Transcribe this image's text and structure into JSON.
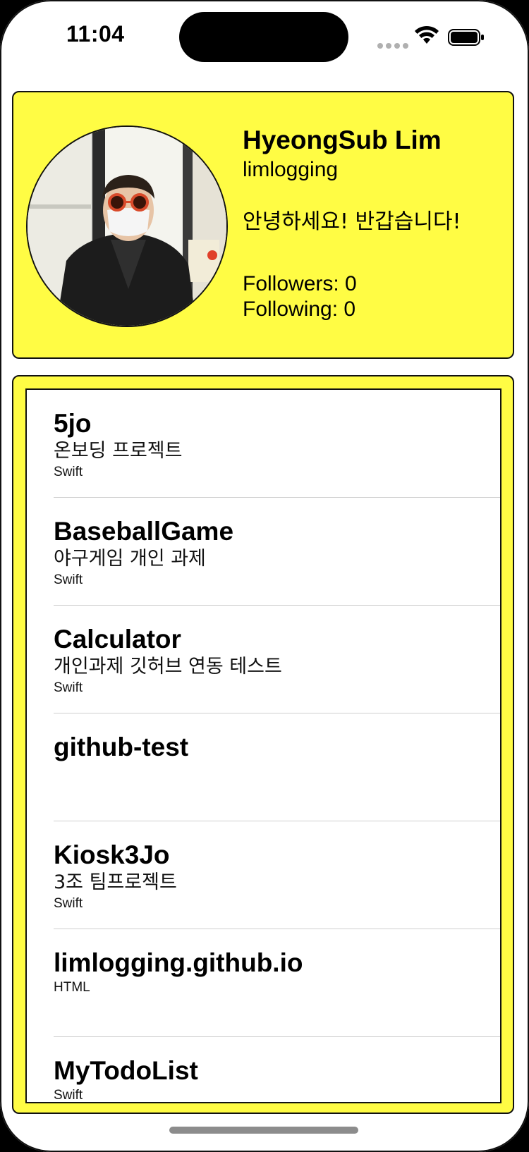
{
  "status_bar": {
    "time": "11:04"
  },
  "profile": {
    "name": "HyeongSub Lim",
    "username": "limlogging",
    "bio": "안녕하세요! 반갑습니다!",
    "followers": "Followers: 0",
    "following": "Following: 0"
  },
  "repos": [
    {
      "name": "5jo",
      "description": "온보딩 프로젝트",
      "language": "Swift"
    },
    {
      "name": "BaseballGame",
      "description": "야구게임 개인 과제",
      "language": "Swift"
    },
    {
      "name": "Calculator",
      "description": "개인과제 깃허브 연동 테스트",
      "language": "Swift"
    },
    {
      "name": "github-test",
      "description": "",
      "language": ""
    },
    {
      "name": "Kiosk3Jo",
      "description": "3조 팀프로젝트",
      "language": "Swift"
    },
    {
      "name": "limlogging.github.io",
      "description": "",
      "language": "HTML"
    },
    {
      "name": "MyTodoList",
      "description": "",
      "language": "Swift"
    }
  ],
  "colors": {
    "card_background": "#fffc44",
    "border": "#111111"
  }
}
